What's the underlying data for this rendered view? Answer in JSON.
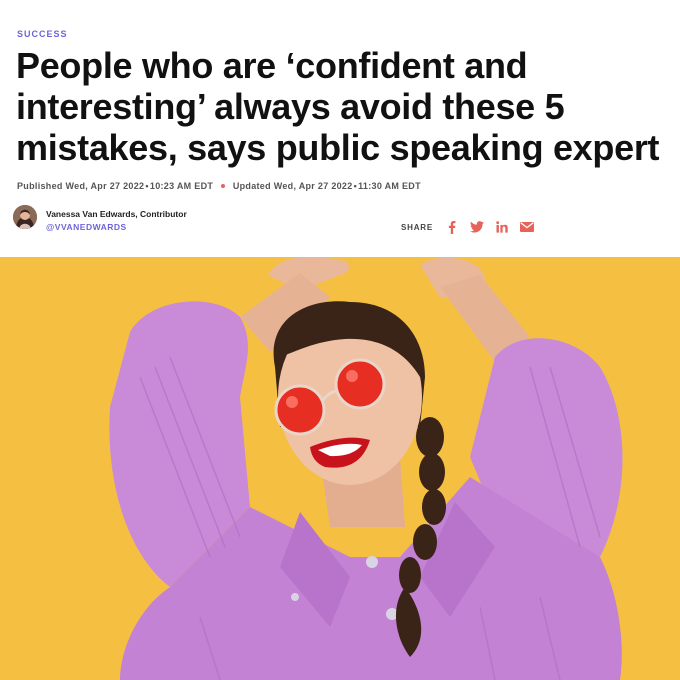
{
  "section": "SUCCESS",
  "headline": "People who are ‘confident and interesting’ always avoid these 5 mistakes, says public speaking expert",
  "published": "Published Wed, Apr 27 2022 • 10:23 AM EDT",
  "updated": "Updated Wed, Apr 27 2022 • 11:30 AM EDT",
  "author": {
    "name": "Vanessa Van Edwards, Contributor",
    "handle": "@VVANEDWARDS"
  },
  "share": {
    "label": "SHARE",
    "icons": [
      "facebook-icon",
      "twitter-icon",
      "linkedin-icon",
      "email-icon"
    ]
  },
  "colors": {
    "accent": "#6f63d9",
    "share_icons": "#e8625a",
    "hero_background": "#f4bd3e",
    "jacket": "#c98ad8"
  }
}
